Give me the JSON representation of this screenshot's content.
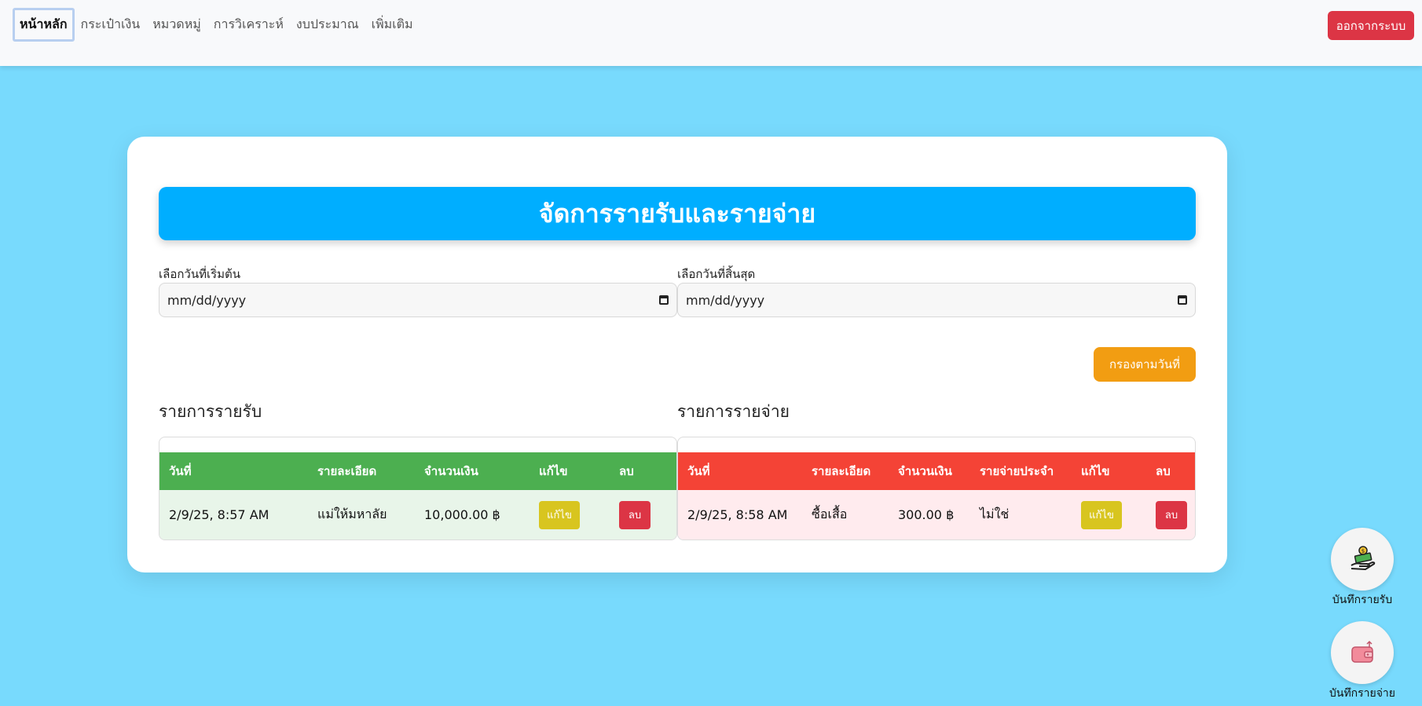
{
  "nav": {
    "items": [
      {
        "label": "หน้าหลัก",
        "active": true
      },
      {
        "label": "กระเป๋าเงิน",
        "active": false
      },
      {
        "label": "หมวดหมู่",
        "active": false
      },
      {
        "label": "การวิเคราะห์",
        "active": false
      },
      {
        "label": "งบประมาณ",
        "active": false
      },
      {
        "label": "เพิ่มเติม",
        "active": false
      }
    ],
    "logout_label": "ออกจากระบบ"
  },
  "main": {
    "title": "จัดการรายรับและรายจ่าย",
    "start_date_label": "เลือกวันที่เริ่มต้น",
    "end_date_label": "เลือกวันที่สิ้นสุด",
    "start_date_placeholder": "mm/dd/yyyy",
    "end_date_placeholder": "mm/dd/yyyy",
    "filter_label": "กรองตามวันที่",
    "income_title": "รายการรายรับ",
    "expense_title": "รายการรายจ่าย"
  },
  "income_table": {
    "headers": [
      "วันที่",
      "รายละเอียด",
      "จำนวนเงิน",
      "แก้ไข",
      "ลบ"
    ],
    "rows": [
      {
        "date": "2/9/25, 8:57 AM",
        "detail": "แม่ให้มหาลัย",
        "amount": "10,000.00 ฿",
        "edit": "แก้ไข",
        "delete": "ลบ"
      }
    ]
  },
  "expense_table": {
    "headers": [
      "วันที่",
      "รายละเอียด",
      "จำนวนเงิน",
      "รายจ่ายประจำ",
      "แก้ไข",
      "ลบ"
    ],
    "rows": [
      {
        "date": "2/9/25, 8:58 AM",
        "detail": "ซื้อเสื้อ",
        "amount": "300.00 ฿",
        "recurring": "ไม่ใช่",
        "edit": "แก้ไข",
        "delete": "ลบ"
      }
    ]
  },
  "fabs": {
    "income_label": "บันทึกรายรับ",
    "expense_label": "บันทึกรายจ่าย",
    "income_icon": "money-hand-icon",
    "expense_icon": "wallet-icon"
  },
  "colors": {
    "background": "#78dafd",
    "banner": "#00aeff",
    "income_header": "#4caf50",
    "expense_header": "#f44336",
    "filter_button": "#f29d12",
    "danger": "#dc3545",
    "edit": "#d8c51f"
  }
}
